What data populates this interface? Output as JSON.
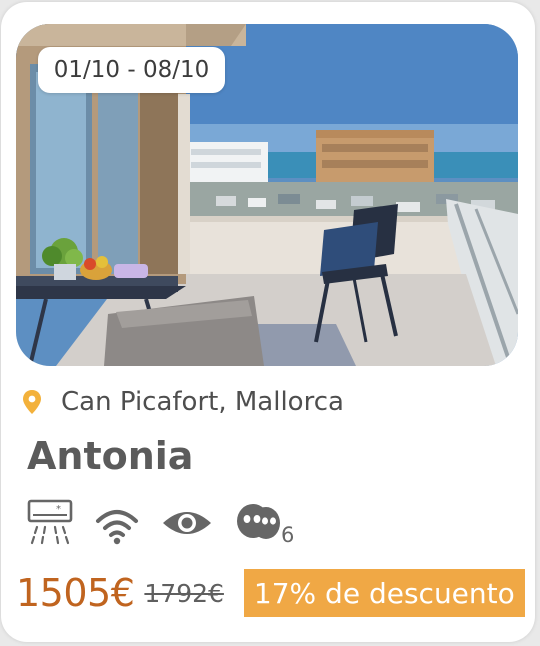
{
  "listing": {
    "dates": "01/10 - 08/10",
    "location": "Can Picafort, Mallorca",
    "title": "Antonia",
    "guests": "6",
    "price": "1505€",
    "old_price": "1792€",
    "discount": "17% de descuento"
  },
  "icons": {
    "location": "map-pin-icon",
    "amenities": [
      "air-conditioning-icon",
      "wifi-icon",
      "sea-view-icon",
      "guests-icon"
    ]
  },
  "colors": {
    "accent_orange": "#f0a845",
    "price_orange": "#c0641f",
    "pin_yellow": "#f3b13b"
  }
}
